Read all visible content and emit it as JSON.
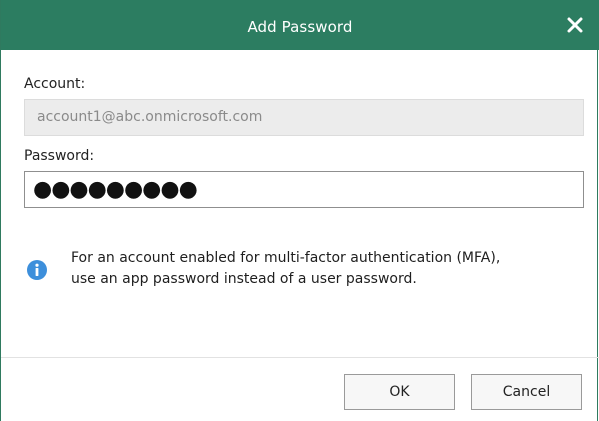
{
  "dialog": {
    "title": "Add Password",
    "close_icon": "close-icon"
  },
  "account": {
    "label": "Account:",
    "value": "account1@abc.onmicrosoft.com"
  },
  "password": {
    "label": "Password:",
    "masked_value": "●●●●●●●●●"
  },
  "info": {
    "icon": "info-icon",
    "line1": "For an account enabled for multi-factor authentication (MFA),",
    "line2": "use an app password instead of a user password."
  },
  "buttons": {
    "ok_label": "OK",
    "cancel_label": "Cancel"
  },
  "colors": {
    "titlebar": "#2c7d61",
    "info_icon": "#3d8fdb"
  }
}
